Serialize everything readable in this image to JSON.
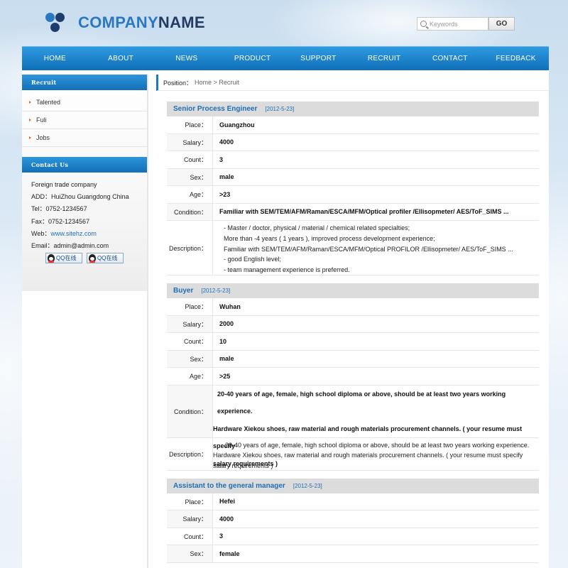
{
  "header": {
    "logo_part1": "COMPANY",
    "logo_part2": "NAME",
    "search_placeholder": "Keywords",
    "go_label": "GO"
  },
  "nav": {
    "items": [
      "HOME",
      "ABOUT",
      "NEWS",
      "PRODUCT",
      "SUPPORT",
      "RECRUIT",
      "CONTACT",
      "FEEDBACK"
    ]
  },
  "sidebar": {
    "recruit_title": "Recruit",
    "recruit_items": [
      "Talented",
      "Fuli",
      "Jobs"
    ],
    "contact_title": "Contact Us",
    "company": "Foreign trade company",
    "address_label": "ADD：",
    "address": "HuiZhou Guangdong China",
    "tel_label": "Tel：",
    "tel": "0752-1234567",
    "fax_label": "Fax：",
    "fax": "0752-1234567",
    "web_label": "Web：",
    "web": "www.sitehz.com",
    "email_label": "Email：",
    "email": "admin@admin.com",
    "qq_label": "QQ在线"
  },
  "breadcrumb": {
    "label": "Position：",
    "home": "Home",
    "sep": ">",
    "current": "Recruit"
  },
  "labels": {
    "place": "Place：",
    "salary": "Salary：",
    "count": "Count：",
    "sex": "Sex：",
    "age": "Age：",
    "condition": "Condition：",
    "description": "Description："
  },
  "jobs": [
    {
      "title": "Senior Process Engineer",
      "date": "[2012-5-23]",
      "place": "Guangzhou",
      "salary": "4000",
      "count": "3",
      "sex": "male",
      "age": ">23",
      "condition": "Familiar with SEM/TEM/AFM/Raman/ESCA/MFM/Optical profiler /Ellisopmeter/ AES/ToF_SIMS ...",
      "description": [
        "- Master / doctor, physical / material / chemical related specialties;",
        "More than -4 years ( 1 years ), improved process development experience;",
        "Familiar with SEM/TEM/AFM/Raman/ESCA/MFM/Optical PROFILOR /Ellisopmeter/ AES/ToF_SIMS ...",
        "- good English level;",
        "- team management experience is preferred."
      ]
    },
    {
      "title": "Buyer",
      "date": "[2012-5-23]",
      "place": "Wuhan",
      "salary": "2000",
      "count": "10",
      "sex": "male",
      "age": ">25",
      "condition": [
        "20-40 years of age, female, high school diploma or above, should be at least two years working experience.",
        "Hardware Xiekou shoes, raw material and rough materials procurement channels. ( your resume must specify",
        "salary requirements )"
      ],
      "description": "20-40 years of age, female, high school diploma or above, should be at least two years working experience. Hardware Xiekou shoes, raw material and rough materials procurement channels. ( your resume must specify salary requirements )"
    },
    {
      "title": "Assistant to the general manager",
      "date": "[2012-5-23]",
      "place": "Hefei",
      "salary": "4000",
      "count": "3",
      "sex": "female"
    }
  ],
  "colors": {
    "accent": "#1b78c4",
    "nav_top": "#2e9ae0",
    "bullet": "#e36a17"
  }
}
